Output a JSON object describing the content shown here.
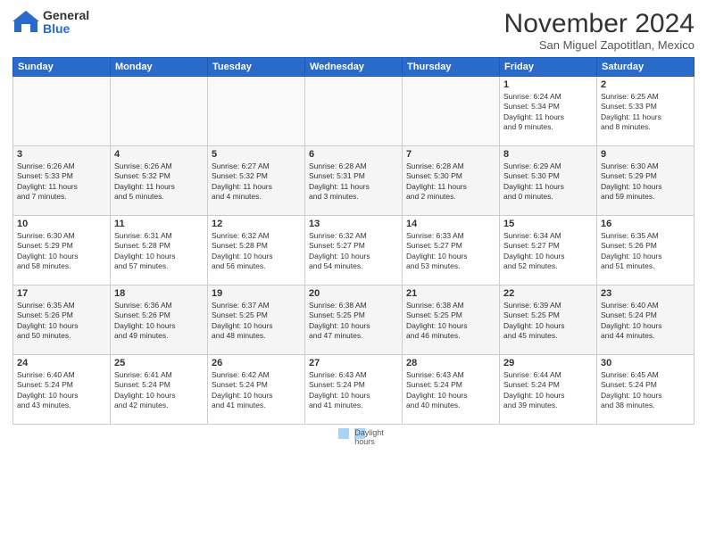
{
  "header": {
    "logo_general": "General",
    "logo_blue": "Blue",
    "month_title": "November 2024",
    "location": "San Miguel Zapotitlan, Mexico"
  },
  "calendar": {
    "days_of_week": [
      "Sunday",
      "Monday",
      "Tuesday",
      "Wednesday",
      "Thursday",
      "Friday",
      "Saturday"
    ],
    "weeks": [
      [
        {
          "day": "",
          "info": "",
          "empty": true
        },
        {
          "day": "",
          "info": "",
          "empty": true
        },
        {
          "day": "",
          "info": "",
          "empty": true
        },
        {
          "day": "",
          "info": "",
          "empty": true
        },
        {
          "day": "",
          "info": "",
          "empty": true
        },
        {
          "day": "1",
          "info": "Sunrise: 6:24 AM\nSunset: 5:34 PM\nDaylight: 11 hours\nand 9 minutes."
        },
        {
          "day": "2",
          "info": "Sunrise: 6:25 AM\nSunset: 5:33 PM\nDaylight: 11 hours\nand 8 minutes."
        }
      ],
      [
        {
          "day": "3",
          "info": "Sunrise: 6:26 AM\nSunset: 5:33 PM\nDaylight: 11 hours\nand 7 minutes."
        },
        {
          "day": "4",
          "info": "Sunrise: 6:26 AM\nSunset: 5:32 PM\nDaylight: 11 hours\nand 5 minutes."
        },
        {
          "day": "5",
          "info": "Sunrise: 6:27 AM\nSunset: 5:32 PM\nDaylight: 11 hours\nand 4 minutes."
        },
        {
          "day": "6",
          "info": "Sunrise: 6:28 AM\nSunset: 5:31 PM\nDaylight: 11 hours\nand 3 minutes."
        },
        {
          "day": "7",
          "info": "Sunrise: 6:28 AM\nSunset: 5:30 PM\nDaylight: 11 hours\nand 2 minutes."
        },
        {
          "day": "8",
          "info": "Sunrise: 6:29 AM\nSunset: 5:30 PM\nDaylight: 11 hours\nand 0 minutes."
        },
        {
          "day": "9",
          "info": "Sunrise: 6:30 AM\nSunset: 5:29 PM\nDaylight: 10 hours\nand 59 minutes."
        }
      ],
      [
        {
          "day": "10",
          "info": "Sunrise: 6:30 AM\nSunset: 5:29 PM\nDaylight: 10 hours\nand 58 minutes."
        },
        {
          "day": "11",
          "info": "Sunrise: 6:31 AM\nSunset: 5:28 PM\nDaylight: 10 hours\nand 57 minutes."
        },
        {
          "day": "12",
          "info": "Sunrise: 6:32 AM\nSunset: 5:28 PM\nDaylight: 10 hours\nand 56 minutes."
        },
        {
          "day": "13",
          "info": "Sunrise: 6:32 AM\nSunset: 5:27 PM\nDaylight: 10 hours\nand 54 minutes."
        },
        {
          "day": "14",
          "info": "Sunrise: 6:33 AM\nSunset: 5:27 PM\nDaylight: 10 hours\nand 53 minutes."
        },
        {
          "day": "15",
          "info": "Sunrise: 6:34 AM\nSunset: 5:27 PM\nDaylight: 10 hours\nand 52 minutes."
        },
        {
          "day": "16",
          "info": "Sunrise: 6:35 AM\nSunset: 5:26 PM\nDaylight: 10 hours\nand 51 minutes."
        }
      ],
      [
        {
          "day": "17",
          "info": "Sunrise: 6:35 AM\nSunset: 5:26 PM\nDaylight: 10 hours\nand 50 minutes."
        },
        {
          "day": "18",
          "info": "Sunrise: 6:36 AM\nSunset: 5:26 PM\nDaylight: 10 hours\nand 49 minutes."
        },
        {
          "day": "19",
          "info": "Sunrise: 6:37 AM\nSunset: 5:25 PM\nDaylight: 10 hours\nand 48 minutes."
        },
        {
          "day": "20",
          "info": "Sunrise: 6:38 AM\nSunset: 5:25 PM\nDaylight: 10 hours\nand 47 minutes."
        },
        {
          "day": "21",
          "info": "Sunrise: 6:38 AM\nSunset: 5:25 PM\nDaylight: 10 hours\nand 46 minutes."
        },
        {
          "day": "22",
          "info": "Sunrise: 6:39 AM\nSunset: 5:25 PM\nDaylight: 10 hours\nand 45 minutes."
        },
        {
          "day": "23",
          "info": "Sunrise: 6:40 AM\nSunset: 5:24 PM\nDaylight: 10 hours\nand 44 minutes."
        }
      ],
      [
        {
          "day": "24",
          "info": "Sunrise: 6:40 AM\nSunset: 5:24 PM\nDaylight: 10 hours\nand 43 minutes."
        },
        {
          "day": "25",
          "info": "Sunrise: 6:41 AM\nSunset: 5:24 PM\nDaylight: 10 hours\nand 42 minutes."
        },
        {
          "day": "26",
          "info": "Sunrise: 6:42 AM\nSunset: 5:24 PM\nDaylight: 10 hours\nand 41 minutes."
        },
        {
          "day": "27",
          "info": "Sunrise: 6:43 AM\nSunset: 5:24 PM\nDaylight: 10 hours\nand 41 minutes."
        },
        {
          "day": "28",
          "info": "Sunrise: 6:43 AM\nSunset: 5:24 PM\nDaylight: 10 hours\nand 40 minutes."
        },
        {
          "day": "29",
          "info": "Sunrise: 6:44 AM\nSunset: 5:24 PM\nDaylight: 10 hours\nand 39 minutes."
        },
        {
          "day": "30",
          "info": "Sunrise: 6:45 AM\nSunset: 5:24 PM\nDaylight: 10 hours\nand 38 minutes."
        }
      ]
    ]
  },
  "legend": {
    "text": "Daylight hours"
  }
}
